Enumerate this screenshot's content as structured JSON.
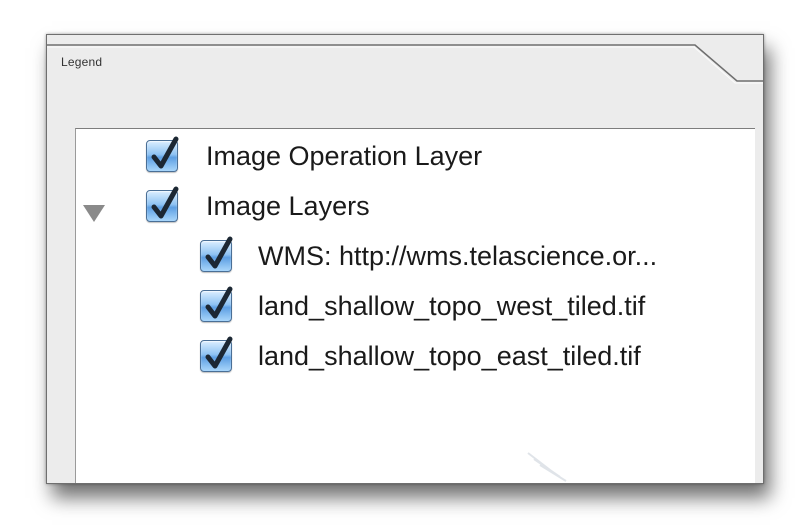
{
  "panel": {
    "title": "Legend"
  },
  "layers": [
    {
      "label": "Image Operation Layer",
      "checked": true,
      "level": 0
    },
    {
      "label": "Image Layers",
      "checked": true,
      "level": 0,
      "expanded": true
    },
    {
      "label": "WMS: http://wms.telascience.or...",
      "checked": true,
      "level": 1
    },
    {
      "label": "land_shallow_topo_west_tiled.tif",
      "checked": true,
      "level": 1
    },
    {
      "label": "land_shallow_topo_east_tiled.tif",
      "checked": true,
      "level": 1
    }
  ],
  "icons": {
    "checkbox": "checkmark-icon",
    "disclosure": "disclosure-triangle-down-icon"
  },
  "colors": {
    "checkbox_fill": "#7fb7ec",
    "checkmark": "#1c2733",
    "panel_background": "#ececec",
    "tree_background": "#ffffff"
  }
}
